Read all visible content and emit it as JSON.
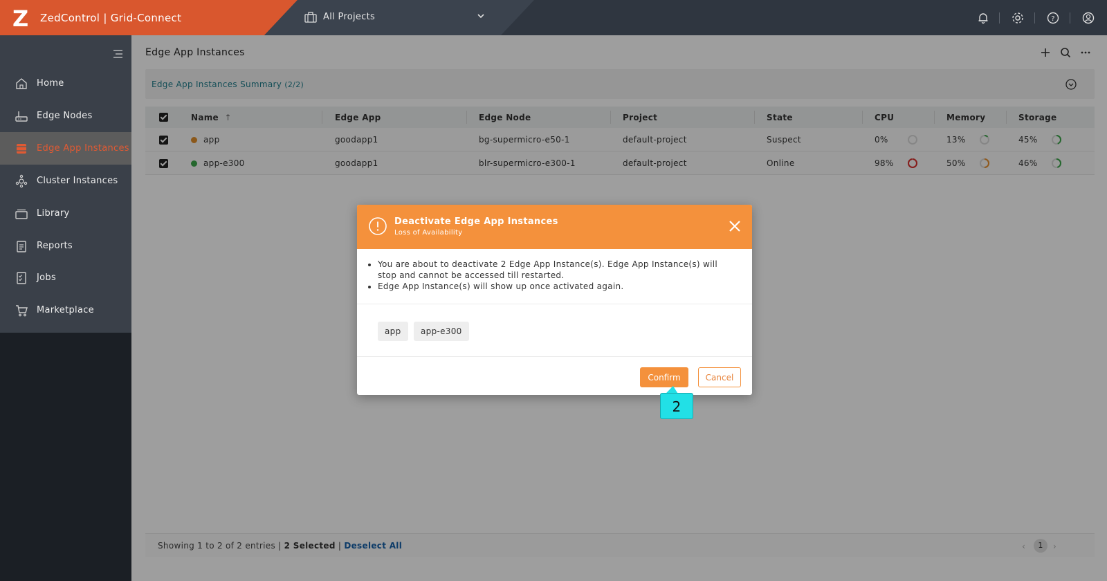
{
  "header": {
    "logo": "Z",
    "app_title": "ZedControl | Grid-Connect",
    "project_selector": "All Projects"
  },
  "sidebar": {
    "items": [
      {
        "label": "Home",
        "icon": "home-icon"
      },
      {
        "label": "Edge Nodes",
        "icon": "router-icon"
      },
      {
        "label": "Edge App Instances",
        "icon": "app-instance-icon",
        "active": true
      },
      {
        "label": "Cluster Instances",
        "icon": "cluster-icon"
      },
      {
        "label": "Library",
        "icon": "library-icon"
      },
      {
        "label": "Reports",
        "icon": "reports-icon"
      },
      {
        "label": "Jobs",
        "icon": "jobs-icon"
      },
      {
        "label": "Marketplace",
        "icon": "cart-icon"
      }
    ]
  },
  "page": {
    "title": "Edge App Instances",
    "summary_title": "Edge App Instances Summary",
    "summary_count": "(2/2)"
  },
  "table": {
    "columns": [
      "Name",
      "Edge App",
      "Edge Node",
      "Project",
      "State",
      "CPU",
      "Memory",
      "Storage"
    ],
    "sort_indicator": "↑",
    "rows": [
      {
        "name": "app",
        "status_color": "#e08e2b",
        "edge_app": "goodapp1",
        "edge_node": "bg-supermicro-e50-1",
        "project": "default-project",
        "state": "Suspect",
        "cpu": "0%",
        "cpu_value": 0,
        "cpu_color": "#cccccc",
        "memory": "13%",
        "memory_value": 13,
        "memory_color": "#3aa64a",
        "storage": "45%",
        "storage_value": 45,
        "storage_color": "#3aa64a"
      },
      {
        "name": "app-e300",
        "status_color": "#3aa64a",
        "edge_app": "goodapp1",
        "edge_node": "blr-supermicro-e300-1",
        "project": "default-project",
        "state": "Online",
        "cpu": "98%",
        "cpu_value": 98,
        "cpu_color": "#d9302c",
        "memory": "50%",
        "memory_value": 50,
        "memory_color": "#e8902e",
        "storage": "46%",
        "storage_value": 46,
        "storage_color": "#3aa64a"
      }
    ]
  },
  "footer": {
    "showing": "Showing 1 to 2 of 2 entries |",
    "selected": "2 Selected",
    "sep": "|",
    "deselect": "Deselect All",
    "page": "1",
    "prev": "‹",
    "next": "›"
  },
  "modal": {
    "title": "Deactivate Edge App Instances",
    "subtitle": "Loss of Availability",
    "messages": [
      "You are about to deactivate 2 Edge App Instance(s). Edge App Instance(s) will stop and cannot be accessed till restarted.",
      "Edge App Instance(s) will show up once activated again."
    ],
    "chips": [
      "app",
      "app-e300"
    ],
    "confirm": "Confirm",
    "cancel": "Cancel"
  },
  "annotation": {
    "step": "2"
  },
  "colors": {
    "brand": "#d9572e",
    "accent": "#f4913c",
    "link": "#1f7d8c"
  }
}
